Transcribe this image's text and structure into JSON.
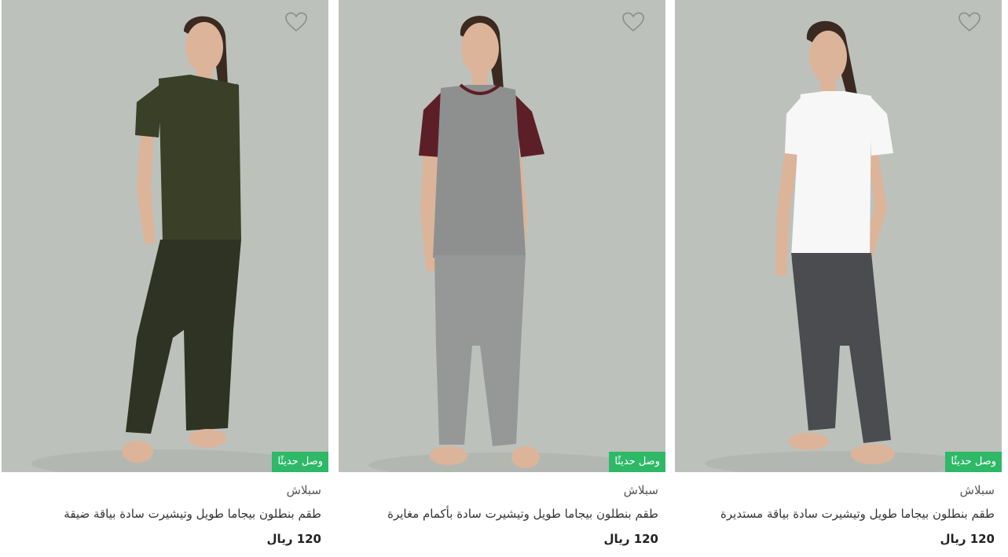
{
  "products": [
    {
      "brand": "سبلاش",
      "title": "طقم بنطلون بيجاما طويل وتيشيرت سادة بياقة ضيقة",
      "price": "120 ريال",
      "badge": "وصل حديثًا",
      "shirt_color": "#3a3f27",
      "sleeve_color": "#3a3f27",
      "pants_color": "#2f3323",
      "background_color": "#bdc1bb"
    },
    {
      "brand": "سبلاش",
      "title": "طقم بنطلون بيجاما طويل وتيشيرت سادة بأكمام مغايرة",
      "price": "120 ريال",
      "badge": "وصل حديثًا",
      "shirt_color": "#8e9090",
      "sleeve_color": "#5c1f27",
      "pants_color": "#969898",
      "background_color": "#bdc1bb"
    },
    {
      "brand": "سبلاش",
      "title": "طقم بنطلون بيجاما طويل وتيشيرت سادة بياقة مستديرة",
      "price": "120 ريال",
      "badge": "وصل حديثًا",
      "shirt_color": "#f7f7f7",
      "sleeve_color": "#f7f7f7",
      "pants_color": "#4a4c50",
      "background_color": "#bdc1bb"
    }
  ],
  "icons": {
    "wishlist": "heart-outline-icon"
  },
  "colors": {
    "badge": "#2eb867",
    "skin": "#dcb49a",
    "hair": "#3b2a20"
  }
}
